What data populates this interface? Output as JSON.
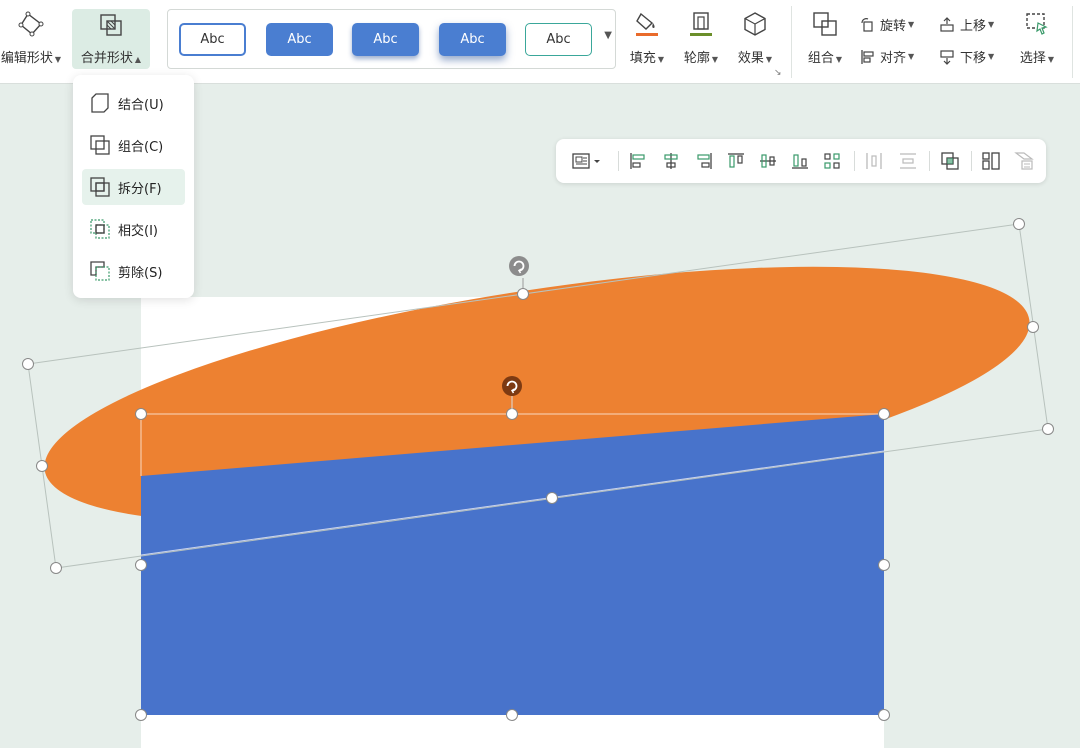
{
  "ribbon": {
    "edit_shape": "编辑形状",
    "merge_shape": "合并形状",
    "fill": "填充",
    "outline": "轮廓",
    "effect": "效果",
    "group": "组合",
    "rotate": "旋转",
    "align": "对齐",
    "bring_forward": "上移",
    "send_backward": "下移",
    "select": "选择"
  },
  "style_gallery": {
    "swatches": [
      "Abc",
      "Abc",
      "Abc",
      "Abc",
      "Abc"
    ]
  },
  "merge_menu": {
    "items": [
      {
        "label": "结合(U)",
        "icon": "union-icon"
      },
      {
        "label": "组合(C)",
        "icon": "combine-icon"
      },
      {
        "label": "拆分(F)",
        "icon": "fragment-icon"
      },
      {
        "label": "相交(I)",
        "icon": "intersect-icon"
      },
      {
        "label": "剪除(S)",
        "icon": "subtract-icon"
      }
    ],
    "highlighted": "拆分(F)"
  },
  "colors": {
    "accent": "#4a7ed1",
    "ellipse_fill": "#ed8131",
    "rectangle_fill": "#4873cb",
    "fill_color_bar": "#e96b2b",
    "outline_color_bar": "#6b8f2a",
    "ribbon_active": "#dcece4",
    "canvas_background": "#e6eeea"
  }
}
